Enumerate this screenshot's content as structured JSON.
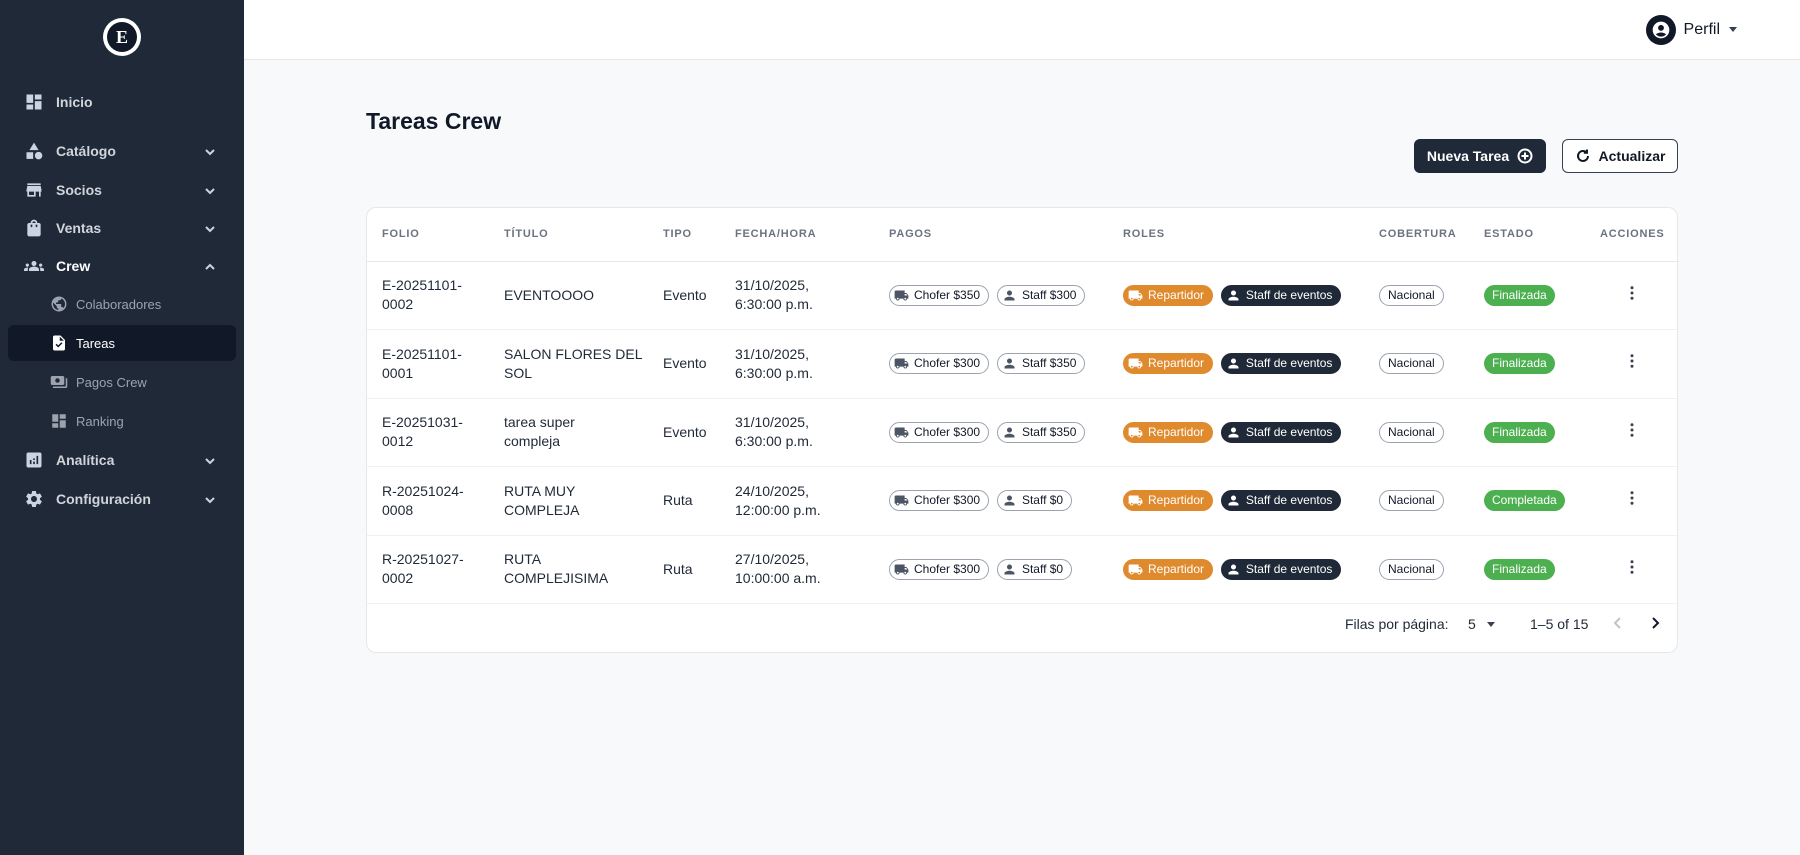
{
  "sidebar": {
    "logo_letter": "E",
    "items": [
      {
        "label": "Inicio",
        "icon": "dashboard-icon"
      },
      {
        "label": "Catálogo",
        "icon": "shapes-icon"
      },
      {
        "label": "Socios",
        "icon": "store-icon"
      },
      {
        "label": "Ventas",
        "icon": "shopping-bag-icon"
      },
      {
        "label": "Crew",
        "icon": "group-icon"
      },
      {
        "label": "Analítica",
        "icon": "analytics-icon"
      },
      {
        "label": "Configuración",
        "icon": "gear-icon"
      }
    ],
    "crew_sub": [
      {
        "label": "Colaboradores",
        "icon": "globe-icon"
      },
      {
        "label": "Tareas",
        "icon": "task-icon"
      },
      {
        "label": "Pagos Crew",
        "icon": "payments-icon"
      },
      {
        "label": "Ranking",
        "icon": "dashboard-icon"
      }
    ]
  },
  "header": {
    "profile_label": "Perfil"
  },
  "page": {
    "title": "Tareas Crew",
    "new_button": "Nueva Tarea",
    "refresh_button": "Actualizar"
  },
  "table": {
    "columns": [
      "FOLIO",
      "TÍTULO",
      "TIPO",
      "FECHA/HORA",
      "PAGOS",
      "ROLES",
      "COBERTURA",
      "ESTADO",
      "ACCIONES"
    ],
    "rows": [
      {
        "folio": [
          "E-20251101-",
          "0002"
        ],
        "titulo": [
          "EVENTOOOO"
        ],
        "tipo": "Evento",
        "fecha": [
          "31/10/2025,",
          "6:30:00 p.m."
        ],
        "pago_chofer": "Chofer $350",
        "pago_staff": "Staff $300",
        "rol1": "Repartidor",
        "rol2": "Staff de eventos",
        "cobertura": "Nacional",
        "estado": "Finalizada"
      },
      {
        "folio": [
          "E-20251101-",
          "0001"
        ],
        "titulo": [
          "SALON FLORES DEL",
          "SOL"
        ],
        "tipo": "Evento",
        "fecha": [
          "31/10/2025,",
          "6:30:00 p.m."
        ],
        "pago_chofer": "Chofer $300",
        "pago_staff": "Staff $350",
        "rol1": "Repartidor",
        "rol2": "Staff de eventos",
        "cobertura": "Nacional",
        "estado": "Finalizada"
      },
      {
        "folio": [
          "E-20251031-",
          "0012"
        ],
        "titulo": [
          "tarea super",
          "compleja"
        ],
        "tipo": "Evento",
        "fecha": [
          "31/10/2025,",
          "6:30:00 p.m."
        ],
        "pago_chofer": "Chofer $300",
        "pago_staff": "Staff $350",
        "rol1": "Repartidor",
        "rol2": "Staff de eventos",
        "cobertura": "Nacional",
        "estado": "Finalizada"
      },
      {
        "folio": [
          "R-20251024-",
          "0008"
        ],
        "titulo": [
          "RUTA MUY",
          "COMPLEJA"
        ],
        "tipo": "Ruta",
        "fecha": [
          "24/10/2025,",
          "12:00:00 p.m."
        ],
        "pago_chofer": "Chofer $300",
        "pago_staff": "Staff $0",
        "rol1": "Repartidor",
        "rol2": "Staff de eventos",
        "cobertura": "Nacional",
        "estado": "Completada"
      },
      {
        "folio": [
          "R-20251027-",
          "0002"
        ],
        "titulo": [
          "RUTA",
          "COMPLEJISIMA"
        ],
        "tipo": "Ruta",
        "fecha": [
          "27/10/2025,",
          "10:00:00 a.m."
        ],
        "pago_chofer": "Chofer $300",
        "pago_staff": "Staff $0",
        "rol1": "Repartidor",
        "rol2": "Staff de eventos",
        "cobertura": "Nacional",
        "estado": "Finalizada"
      }
    ]
  },
  "pagination": {
    "rows_label": "Filas por página:",
    "rows_value": "5",
    "range": "1–5 of 15"
  },
  "colors": {
    "sidebar_bg": "#1f2937",
    "accent_orange": "#e08a2e",
    "status_green": "#4caf50"
  }
}
